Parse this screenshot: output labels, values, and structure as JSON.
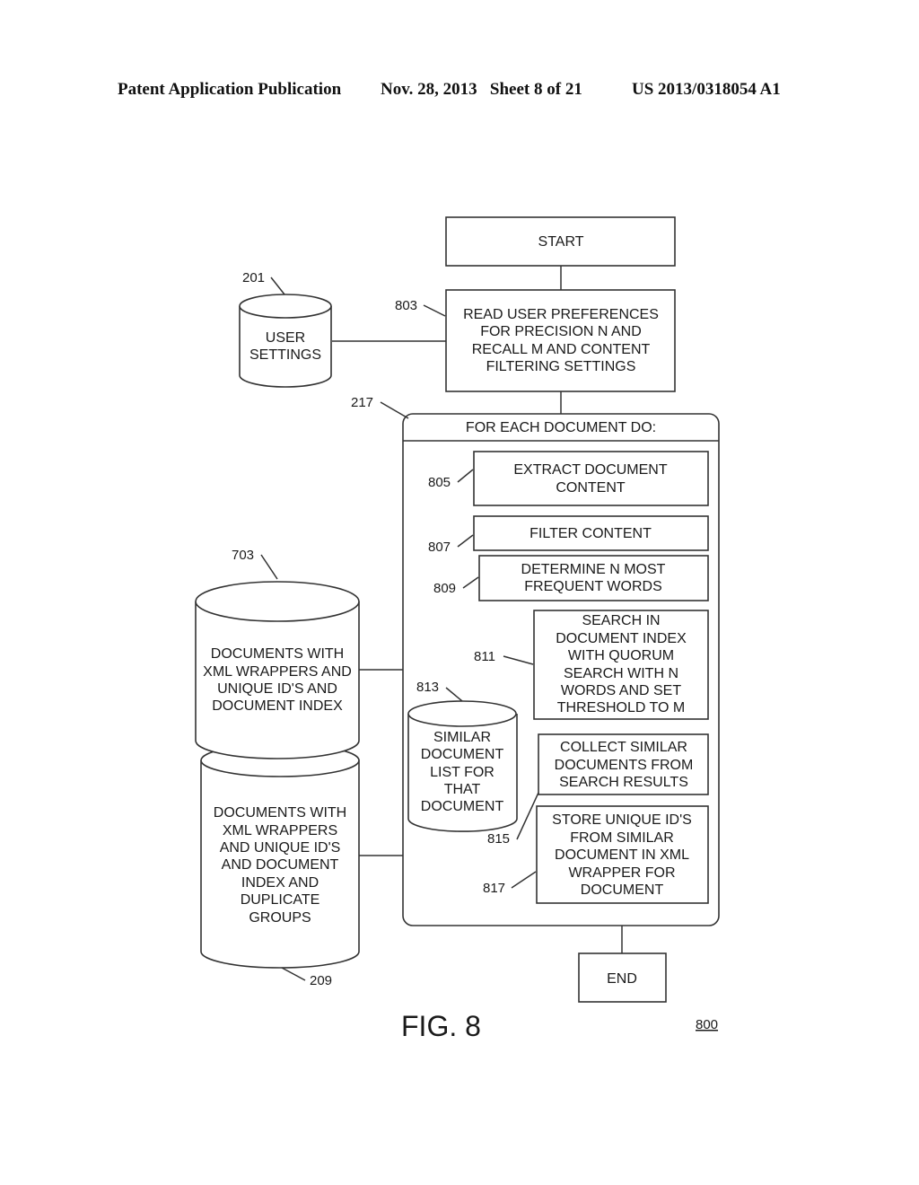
{
  "header": {
    "publication": "Patent Application Publication",
    "date_sheet": "Nov. 28, 2013   Sheet 8 of 21",
    "number": "US 2013/0318054 A1"
  },
  "figure": {
    "caption": "FIG. 8",
    "ref": "800"
  },
  "nodes": {
    "start": {
      "lines": [
        "START"
      ]
    },
    "read_prefs": {
      "ref": "803",
      "lines": [
        "READ USER PREFERENCES",
        "FOR PRECISION N AND",
        "RECALL M AND CONTENT",
        "FILTERING SETTINGS"
      ]
    },
    "user_settings": {
      "ref": "201",
      "lines": [
        "USER",
        "SETTINGS"
      ]
    },
    "loop": {
      "ref": "217",
      "title": "FOR EACH DOCUMENT DO:"
    },
    "extract": {
      "ref": "805",
      "lines": [
        "EXTRACT DOCUMENT",
        "CONTENT"
      ]
    },
    "filter": {
      "ref": "807",
      "lines": [
        "FILTER CONTENT"
      ]
    },
    "determine": {
      "ref": "809",
      "lines": [
        "DETERMINE N MOST",
        "FREQUENT WORDS"
      ]
    },
    "search": {
      "ref": "811",
      "lines": [
        "SEARCH IN",
        "DOCUMENT INDEX",
        "WITH QUORUM",
        "SEARCH WITH N",
        "WORDS AND SET",
        "THRESHOLD TO M"
      ]
    },
    "similar_list": {
      "ref": "813",
      "lines": [
        "SIMILAR",
        "DOCUMENT",
        "LIST FOR",
        "THAT",
        "DOCUMENT"
      ]
    },
    "collect": {
      "ref": "815",
      "lines": [
        "COLLECT SIMILAR",
        "DOCUMENTS FROM",
        "SEARCH RESULTS"
      ]
    },
    "store": {
      "ref": "817",
      "lines": [
        "STORE UNIQUE ID'S",
        "FROM SIMILAR",
        "DOCUMENT IN XML",
        "WRAPPER FOR",
        "DOCUMENT"
      ]
    },
    "docs_index": {
      "ref": "703",
      "lines": [
        "DOCUMENTS WITH",
        "XML WRAPPERS AND",
        "UNIQUE ID'S AND",
        "DOCUMENT INDEX"
      ]
    },
    "docs_dup": {
      "ref": "209",
      "lines": [
        "DOCUMENTS WITH",
        "XML WRAPPERS",
        "AND UNIQUE ID'S",
        "AND DOCUMENT",
        "INDEX AND",
        "DUPLICATE",
        "GROUPS"
      ]
    },
    "end": {
      "lines": [
        "END"
      ]
    }
  }
}
